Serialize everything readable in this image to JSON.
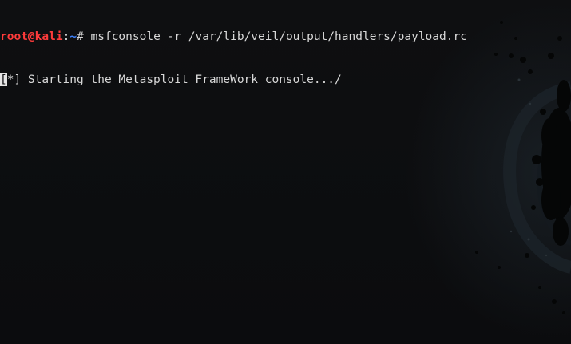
{
  "terminal": {
    "prompt": {
      "user_host": "root@kali",
      "separator": ":",
      "path": "~",
      "symbol": "# "
    },
    "command": "msfconsole -r /var/lib/veil/output/handlers/payload.rc",
    "output_line": {
      "cursor_char": "[",
      "text": "*] Starting the Metasploit FrameWork console.../"
    }
  },
  "colors": {
    "background": "#0c0d0f",
    "text": "#d8d8d8",
    "prompt_user": "#ff3b3b",
    "prompt_path": "#3f83ff",
    "cursor": "#e6e6e6"
  },
  "icons": {
    "wallpaper": "kali-dragon-logo"
  }
}
